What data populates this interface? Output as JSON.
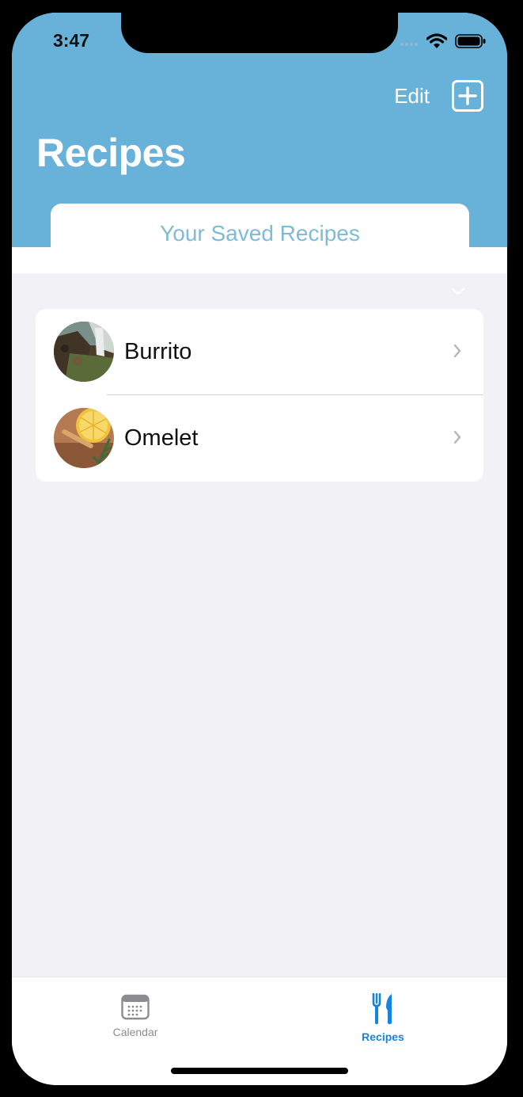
{
  "status_bar": {
    "time": "3:47",
    "icons": [
      "cellular-signal-icon",
      "wifi-icon",
      "battery-icon"
    ]
  },
  "nav": {
    "edit_label": "Edit",
    "add_icon": "plus-square-icon",
    "title": "Recipes"
  },
  "segment": {
    "label": "Your Saved Recipes"
  },
  "recipes": [
    {
      "name": "Burrito",
      "thumbnail": "photo"
    },
    {
      "name": "Omelet",
      "thumbnail": "photo"
    }
  ],
  "tabbar": {
    "items": [
      {
        "label": "Calendar",
        "icon": "calendar-icon",
        "active": false
      },
      {
        "label": "Recipes",
        "icon": "fork-knife-icon",
        "active": true
      }
    ]
  },
  "colors": {
    "header": "#68b2da",
    "background": "#f1f1f6",
    "segment_text": "#7fbad6",
    "active_tab": "#1583e0",
    "inactive_tab": "#8c8c90"
  }
}
